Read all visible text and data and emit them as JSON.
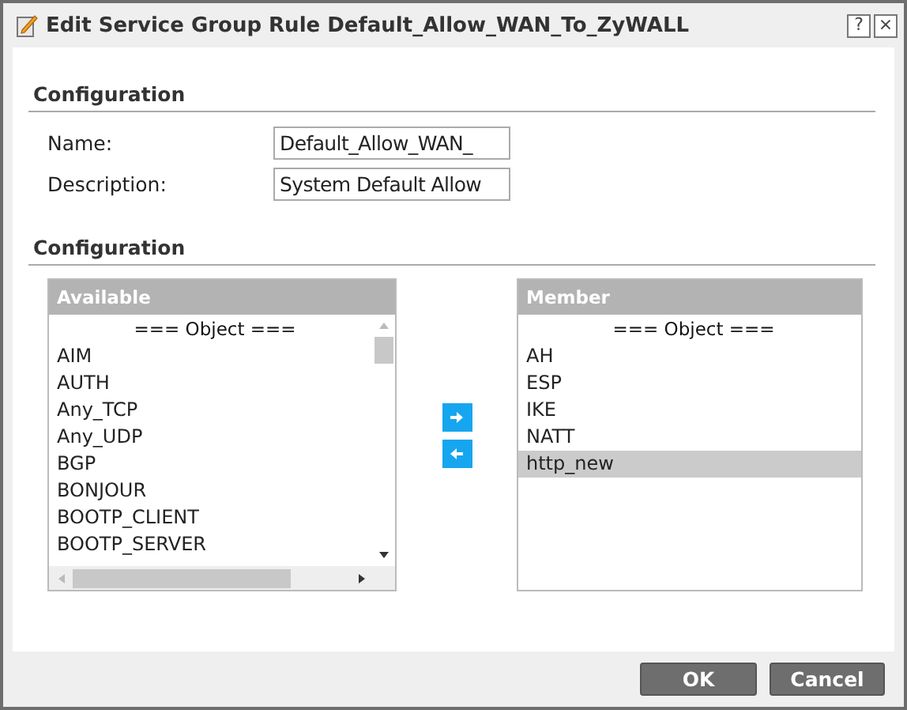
{
  "window": {
    "title": "Edit Service Group Rule Default_Allow_WAN_To_ZyWALL"
  },
  "title_buttons": [
    "?",
    "×"
  ],
  "general": {
    "heading": "Configuration",
    "fields": [
      {
        "label": "Name:",
        "value": "Default_Allow_WAN_"
      },
      {
        "label": "Description:",
        "value": "System Default Allow"
      }
    ]
  },
  "members": {
    "heading": "Configuration",
    "available": {
      "header": "Available",
      "items": [
        {
          "label": "=== Object ===",
          "kind": "group",
          "selected": false
        },
        {
          "label": "AIM",
          "kind": "item",
          "selected": false
        },
        {
          "label": "AUTH",
          "kind": "item",
          "selected": false
        },
        {
          "label": "Any_TCP",
          "kind": "item",
          "selected": false
        },
        {
          "label": "Any_UDP",
          "kind": "item",
          "selected": false
        },
        {
          "label": "BGP",
          "kind": "item",
          "selected": false
        },
        {
          "label": "BONJOUR",
          "kind": "item",
          "selected": false
        },
        {
          "label": "BOOTP_CLIENT",
          "kind": "item",
          "selected": false
        },
        {
          "label": "BOOTP_SERVER",
          "kind": "item",
          "selected": false
        }
      ]
    },
    "member": {
      "header": "Member",
      "items": [
        {
          "label": "=== Object ===",
          "kind": "group",
          "selected": false
        },
        {
          "label": "AH",
          "kind": "item",
          "selected": false
        },
        {
          "label": "ESP",
          "kind": "item",
          "selected": false
        },
        {
          "label": "IKE",
          "kind": "item",
          "selected": false
        },
        {
          "label": "NATT",
          "kind": "item",
          "selected": false
        },
        {
          "label": "http_new",
          "kind": "item",
          "selected": true
        }
      ]
    }
  },
  "buttons": [
    "OK",
    "Cancel"
  ]
}
